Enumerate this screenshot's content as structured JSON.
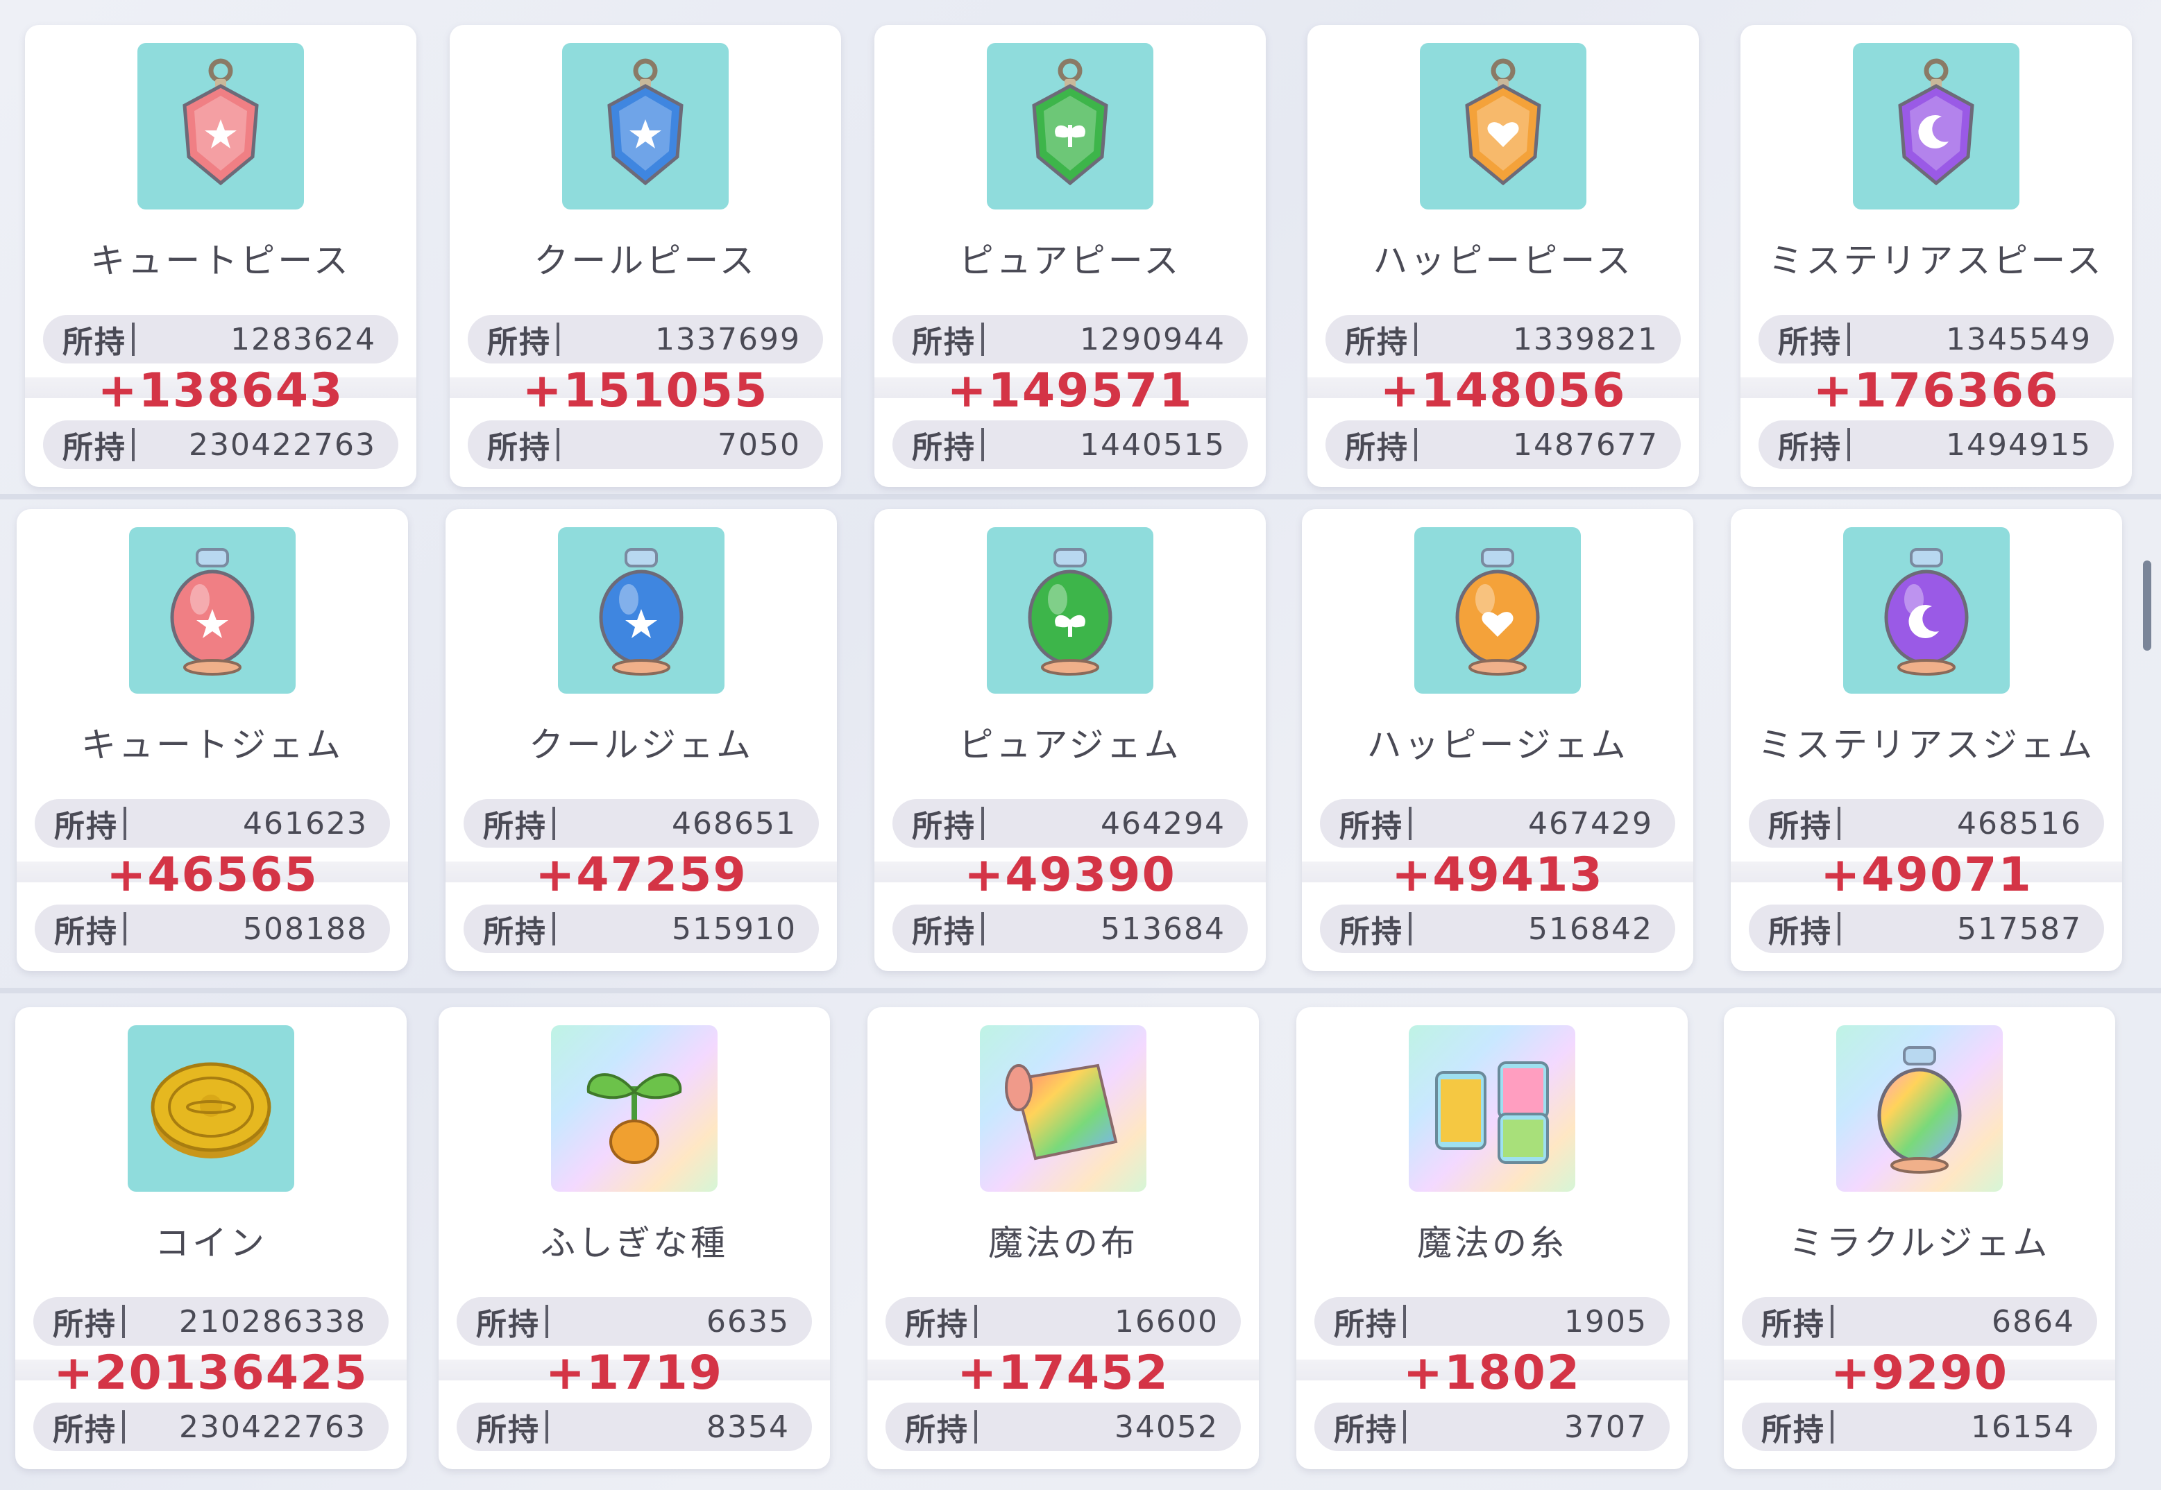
{
  "own_label": "所持",
  "items": [
    {
      "name": "キュートピース",
      "before": "1283624",
      "gain": "+138643",
      "after": "230422763",
      "color": "#f07f84",
      "icon": "pendant-star-icon"
    },
    {
      "name": "クールピース",
      "before": "1337699",
      "gain": "+151055",
      "after": "7050",
      "color": "#3f86e0",
      "icon": "pendant-star-icon"
    },
    {
      "name": "ピュアピース",
      "before": "1290944",
      "gain": "+149571",
      "after": "1440515",
      "color": "#3db54a",
      "icon": "pendant-leaf-icon"
    },
    {
      "name": "ハッピーピース",
      "before": "1339821",
      "gain": "+148056",
      "after": "1487677",
      "color": "#f4a23a",
      "icon": "pendant-heart-icon"
    },
    {
      "name": "ミステリアスピース",
      "before": "1345549",
      "gain": "+176366",
      "after": "1494915",
      "color": "#9a5ae6",
      "icon": "pendant-moon-icon"
    },
    {
      "name": "キュートジェム",
      "before": "461623",
      "gain": "+46565",
      "after": "508188",
      "color": "#f07f84",
      "icon": "gem-bottle-star-icon"
    },
    {
      "name": "クールジェム",
      "before": "468651",
      "gain": "+47259",
      "after": "515910",
      "color": "#3f86e0",
      "icon": "gem-bottle-star-icon"
    },
    {
      "name": "ピュアジェム",
      "before": "464294",
      "gain": "+49390",
      "after": "513684",
      "color": "#3db54a",
      "icon": "gem-bottle-leaf-icon"
    },
    {
      "name": "ハッピージェム",
      "before": "467429",
      "gain": "+49413",
      "after": "516842",
      "color": "#f4a23a",
      "icon": "gem-bottle-heart-icon"
    },
    {
      "name": "ミステリアスジェム",
      "before": "468516",
      "gain": "+49071",
      "after": "517587",
      "color": "#9a5ae6",
      "icon": "gem-bottle-moon-icon"
    },
    {
      "name": "コイン",
      "before": "210286338",
      "gain": "+20136425",
      "after": "230422763",
      "color": "#e6b820",
      "icon": "coin-icon"
    },
    {
      "name": "ふしぎな種",
      "before": "6635",
      "gain": "+1719",
      "after": "8354",
      "color": "#f0a030",
      "icon": "seed-icon"
    },
    {
      "name": "魔法の布",
      "before": "16600",
      "gain": "+17452",
      "after": "34052",
      "color": "#f08060",
      "icon": "fabric-roll-icon"
    },
    {
      "name": "魔法の糸",
      "before": "1905",
      "gain": "+1802",
      "after": "3707",
      "color": "#f5c842",
      "icon": "thread-spools-icon"
    },
    {
      "name": "ミラクルジェム",
      "before": "6864",
      "gain": "+9290",
      "after": "16154",
      "color": "#ff9ec0",
      "icon": "rainbow-gem-bottle-icon"
    }
  ]
}
